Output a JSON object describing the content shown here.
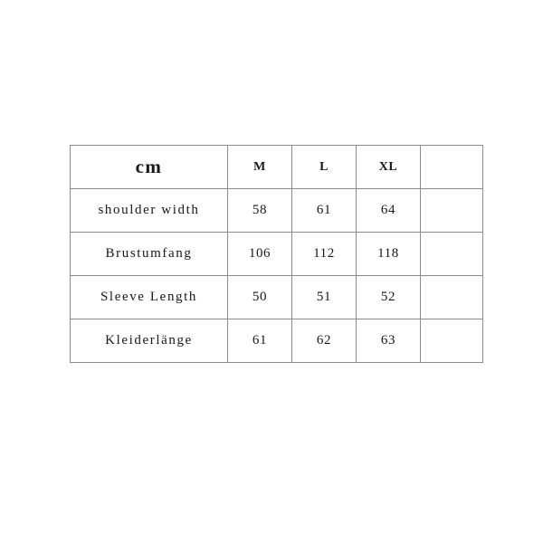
{
  "table": {
    "unit_label": "cm",
    "size_headers": [
      "M",
      "L",
      "XL"
    ],
    "spare_header": "",
    "rows": [
      {
        "label": "shoulder width",
        "values": [
          "58",
          "61",
          "64"
        ],
        "spare": ""
      },
      {
        "label": "Brustumfang",
        "values": [
          "106",
          "112",
          "118"
        ],
        "spare": ""
      },
      {
        "label": "Sleeve Length",
        "values": [
          "50",
          "51",
          "52"
        ],
        "spare": ""
      },
      {
        "label": "Kleiderlänge",
        "values": [
          "61",
          "62",
          "63"
        ],
        "spare": ""
      }
    ]
  },
  "colors": {
    "background": "#ffffff",
    "border": "#8c8c8c",
    "text": "#17171c"
  }
}
